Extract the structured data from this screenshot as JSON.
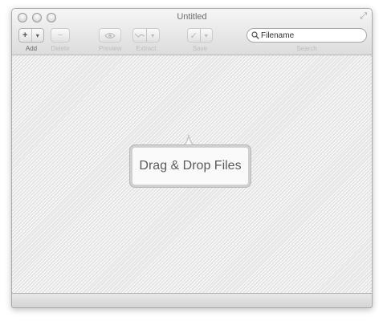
{
  "window": {
    "title": "Untitled"
  },
  "toolbar": {
    "add": {
      "label": "Add",
      "glyph": "+",
      "menu_glyph": "▾"
    },
    "delete": {
      "label": "Delete",
      "glyph": "−"
    },
    "preview": {
      "label": "Preview",
      "icon": "eye-icon"
    },
    "extract": {
      "label": "Extract",
      "icon": "extract-icon",
      "menu_glyph": "▾"
    },
    "save": {
      "label": "Save",
      "glyph": "✓",
      "menu_glyph": "▾"
    }
  },
  "search": {
    "label": "Search",
    "placeholder": "Filename",
    "icon": "magnifier-icon"
  },
  "dropzone": {
    "text": "Drag & Drop Files"
  }
}
